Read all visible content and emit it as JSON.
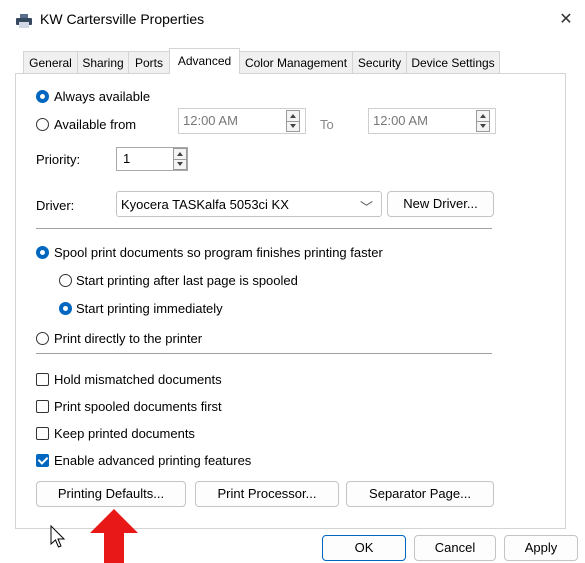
{
  "window": {
    "title": "KW Cartersville Properties",
    "close_glyph": "✕"
  },
  "tabs": [
    {
      "label": "General"
    },
    {
      "label": "Sharing"
    },
    {
      "label": "Ports"
    },
    {
      "label": "Advanced"
    },
    {
      "label": "Color Management"
    },
    {
      "label": "Security"
    },
    {
      "label": "Device Settings"
    }
  ],
  "active_tab": "Advanced",
  "availability": {
    "always_label": "Always available",
    "from_label": "Available from",
    "from_time": "12:00 AM",
    "to_label": "To",
    "to_time": "12:00 AM",
    "selected": "always"
  },
  "priority": {
    "label": "Priority:",
    "value": "1"
  },
  "driver": {
    "label": "Driver:",
    "value": "Kyocera TASKalfa 5053ci KX",
    "new_button": "New Driver..."
  },
  "spool": {
    "spool_label": "Spool print documents so program finishes printing faster",
    "after_last_label": "Start printing after last page is spooled",
    "immediately_label": "Start printing immediately",
    "direct_label": "Print directly to the printer",
    "mode": "spool",
    "start": "immediately"
  },
  "options": [
    {
      "label": "Hold mismatched documents",
      "checked": false
    },
    {
      "label": "Print spooled documents first",
      "checked": false
    },
    {
      "label": "Keep printed documents",
      "checked": false
    },
    {
      "label": "Enable advanced printing features",
      "checked": true
    }
  ],
  "bottom_buttons": {
    "printing_defaults": "Printing Defaults...",
    "print_processor": "Print Processor...",
    "separator_page": "Separator Page..."
  },
  "dialog_buttons": {
    "ok": "OK",
    "cancel": "Cancel",
    "apply": "Apply"
  },
  "colors": {
    "accent": "#0067c0",
    "annotation_arrow": "#e81818"
  }
}
